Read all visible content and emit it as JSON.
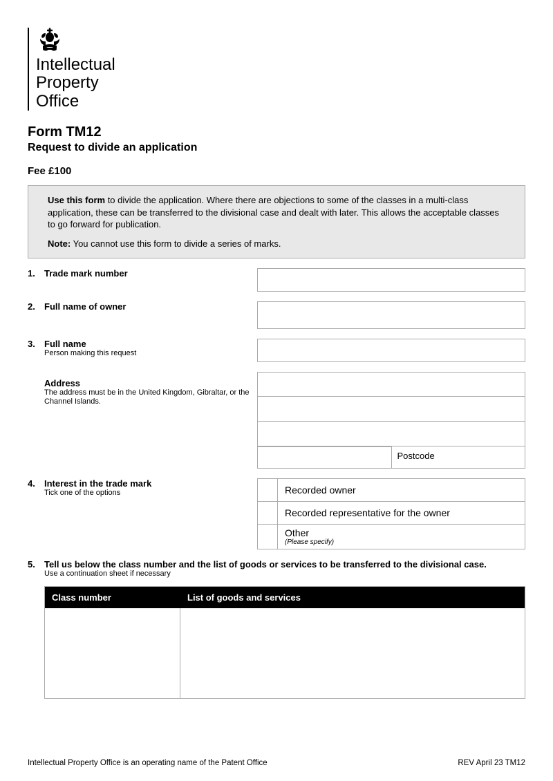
{
  "org": {
    "line1": "Intellectual",
    "line2": "Property",
    "line3": "Office"
  },
  "form": {
    "code": "Form TM12",
    "title": "Request to divide an application",
    "fee": "Fee  £100"
  },
  "info": {
    "useIntro": "Use this form",
    "useText": " to divide the application. Where there are objections to some of the classes in a multi-class application, these can be transferred to the divisional case and dealt with later.  This allows the acceptable classes to go forward for publication.",
    "noteIntro": "Note:",
    "noteText": " You cannot use this form to divide a series of marks."
  },
  "q1": {
    "num": "1.",
    "label": "Trade mark number"
  },
  "q2": {
    "num": "2.",
    "label": "Full name of owner"
  },
  "q3": {
    "num": "3.",
    "nameLabel": "Full name",
    "nameSub": "Person making this request",
    "addrLabel": "Address",
    "addrSub": "The address must be in the United Kingdom, Gibraltar, or the Channel Islands.",
    "postcode": "Postcode"
  },
  "q4": {
    "num": "4.",
    "label": "Interest in the trade mark",
    "sub": "Tick one of the options",
    "opt1": "Recorded owner",
    "opt2": "Recorded representative for the owner",
    "opt3": "Other",
    "opt3sub": "(Please specify)"
  },
  "q5": {
    "num": "5.",
    "label": "Tell us below the class number and the list of goods or services to be transferred to the divisional case.",
    "sub": "Use a continuation sheet if necessary",
    "col1": "Class number",
    "col2": "List of goods and services"
  },
  "footer": {
    "left": "Intellectual Property Office is an operating name of the Patent Office",
    "right": "REV April 23 TM12"
  }
}
